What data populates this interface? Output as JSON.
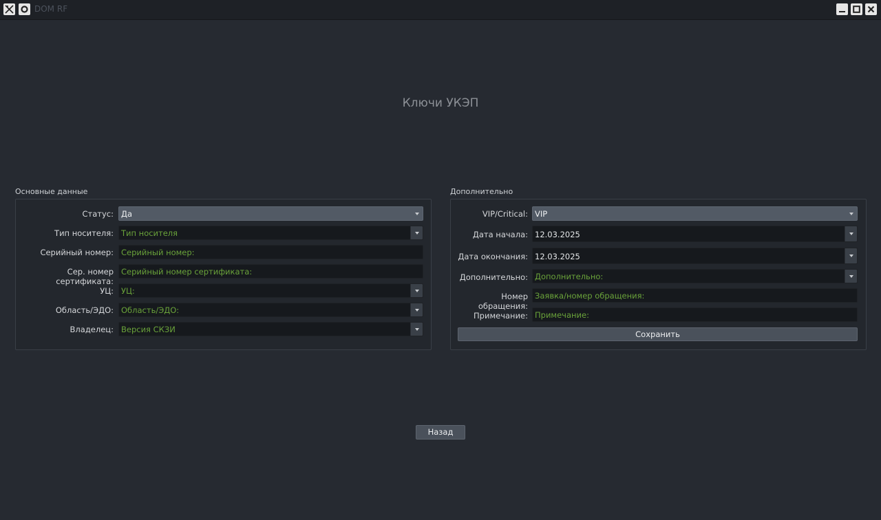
{
  "window": {
    "title": "DOM RF"
  },
  "page": {
    "title": "Ключи УКЭП"
  },
  "main_group": {
    "title": "Основные данные",
    "status": {
      "label": "Статус:",
      "value": "Да"
    },
    "media_type": {
      "label": "Тип носителя:",
      "placeholder": "Тип носителя"
    },
    "serial": {
      "label": "Серийный номер:",
      "placeholder": "Серийный номер:"
    },
    "cert_serial": {
      "label": "Сер. номер сертификата:",
      "placeholder": "Серийный номер сертификата:"
    },
    "ca": {
      "label": "УЦ:",
      "placeholder": "УЦ:"
    },
    "region": {
      "label": "Область/ЭДО:",
      "placeholder": "Область/ЭДО:"
    },
    "owner": {
      "label": "Владелец:",
      "placeholder": "Версия СКЗИ"
    }
  },
  "extra_group": {
    "title": "Дополнительно",
    "vip": {
      "label": "VIP/Critical:",
      "value": "VIP"
    },
    "start_date": {
      "label": "Дата начала:",
      "value": "12.03.2025"
    },
    "end_date": {
      "label": "Дата окончания:",
      "value": "12.03.2025"
    },
    "additional": {
      "label": "Дополнительно:",
      "placeholder": "Дополнительно:"
    },
    "request_no": {
      "label": "Номер обращения:",
      "placeholder": "Заявка/номер обращения:"
    },
    "note": {
      "label": "Примечание:",
      "placeholder": "Примечание:"
    },
    "save_label": "Сохранить"
  },
  "back_label": "Назад",
  "colors": {
    "placeholder": "#6aa33a",
    "background": "#262a31",
    "field": "#16191d"
  }
}
